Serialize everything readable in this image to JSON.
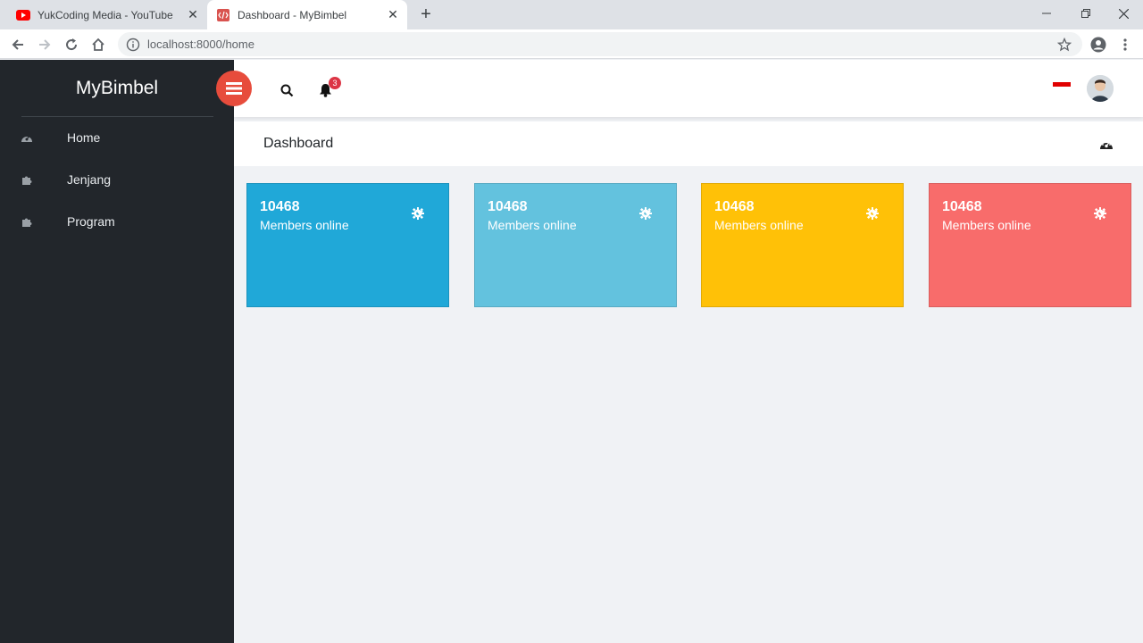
{
  "browser": {
    "tabs": [
      {
        "title": "YukCoding Media - YouTube",
        "favicon": "youtube-icon",
        "active": false
      },
      {
        "title": "Dashboard - MyBimbel",
        "favicon": "code-icon",
        "active": true
      }
    ],
    "url": {
      "host": "localhost",
      "rest": ":8000/home"
    }
  },
  "app": {
    "brand": "MyBimbel",
    "sidebar": {
      "items": [
        {
          "label": "Home",
          "icon": "dashboard-icon"
        },
        {
          "label": "Jenjang",
          "icon": "puzzle-icon"
        },
        {
          "label": "Program",
          "icon": "puzzle-icon"
        }
      ]
    },
    "topbar": {
      "notifications_count": "3"
    },
    "page": {
      "title": "Dashboard"
    },
    "cards": [
      {
        "value": "10468",
        "label": "Members online",
        "color": "#20a8d8"
      },
      {
        "value": "10468",
        "label": "Members online",
        "color": "#63c2de"
      },
      {
        "value": "10468",
        "label": "Members online",
        "color": "#ffc107"
      },
      {
        "value": "10468",
        "label": "Members online",
        "color": "#f86c6b"
      }
    ]
  },
  "colors": {
    "sidebar_bg": "#22262b",
    "hamburger_bg": "#e74c3c",
    "content_bg": "#f0f2f5"
  }
}
